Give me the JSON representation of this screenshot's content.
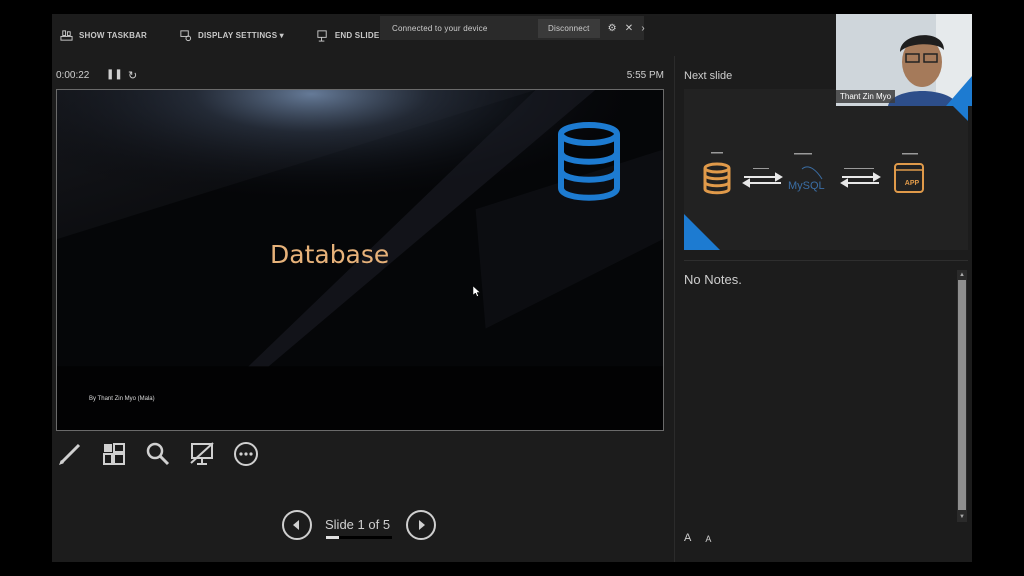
{
  "toolbar": {
    "show_taskbar": "SHOW TASKBAR",
    "display_settings": "DISPLAY SETTINGS ▾",
    "end_slide_show": "END SLIDE SH"
  },
  "connection": {
    "message": "Connected to your device",
    "disconnect": "Disconnect"
  },
  "timer": {
    "elapsed": "0:00:22",
    "clock": "5:55 PM"
  },
  "slide": {
    "title": "Database",
    "author": "By Thant Zin Myo (Mala)"
  },
  "tools": [
    "pen-icon",
    "see-all-slides-icon",
    "zoom-icon",
    "black-screen-icon",
    "more-options-icon"
  ],
  "navigation": {
    "label": "Slide 1 of 5",
    "progress": 0.2
  },
  "next_slide": {
    "label": "Next slide",
    "app_text": "APP",
    "mysql_text": "MySQL"
  },
  "notes": {
    "text": "No Notes."
  },
  "font_controls": {
    "increase": "A",
    "decrease": "A"
  },
  "webcam": {
    "name": "Thant Zin Myo"
  },
  "colors": {
    "accent_blue": "#1d7bd1",
    "title_orange": "#e7b27a",
    "panel_bg": "#1c1c1c"
  }
}
